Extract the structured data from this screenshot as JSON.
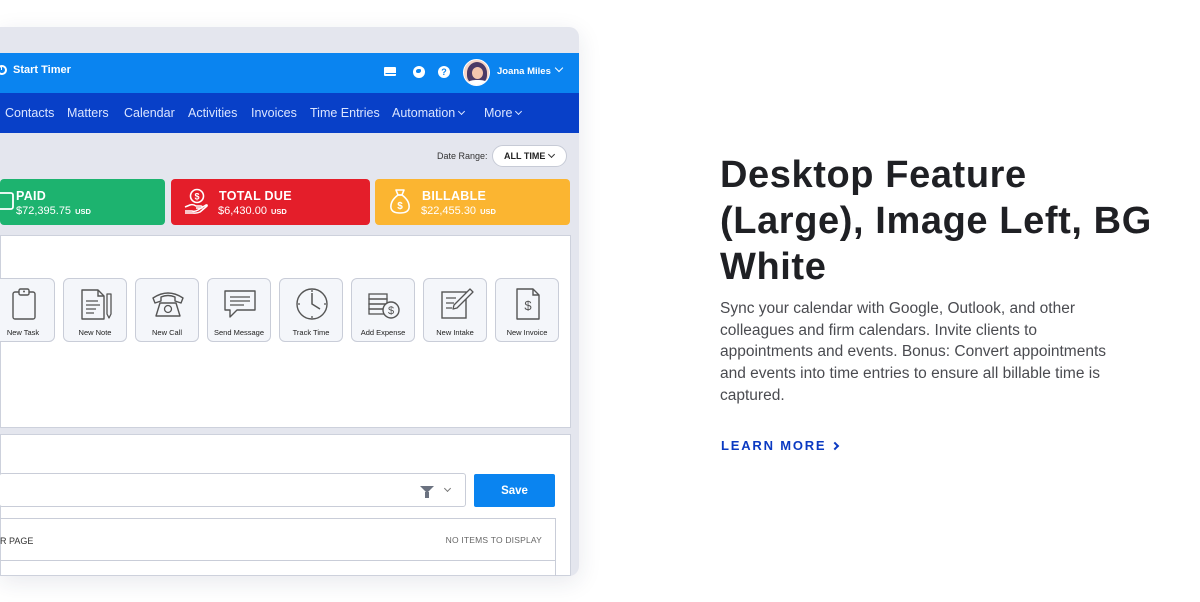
{
  "app": {
    "topbar": {
      "start_timer": "Start Timer",
      "user_name": "Joana Miles"
    },
    "nav": {
      "items": [
        "Contacts",
        "Matters",
        "Calendar",
        "Activities",
        "Invoices",
        "Time Entries",
        "Automation",
        "More"
      ]
    },
    "date_range": {
      "label": "Date Range:",
      "value": "ALL TIME"
    },
    "stats": {
      "paid": {
        "title": "PAID",
        "amount": "$72,395.75",
        "currency": "USD",
        "color": "#1db36f"
      },
      "total_due": {
        "title": "TOTAL DUE",
        "amount": "$6,430.00",
        "currency": "USD",
        "color": "#e41e2a"
      },
      "billable": {
        "title": "BILLABLE",
        "amount": "$22,455.30",
        "currency": "USD",
        "color": "#fbb531"
      }
    },
    "quick_actions": [
      {
        "label": "New Task",
        "icon": "clipboard-icon"
      },
      {
        "label": "New Note",
        "icon": "note-icon"
      },
      {
        "label": "New Call",
        "icon": "phone-icon"
      },
      {
        "label": "Send Message",
        "icon": "message-icon"
      },
      {
        "label": "Track Time",
        "icon": "clock-icon"
      },
      {
        "label": "Add Expense",
        "icon": "expense-icon"
      },
      {
        "label": "New Intake",
        "icon": "intake-icon"
      },
      {
        "label": "New Invoice",
        "icon": "invoice-icon"
      }
    ],
    "filter": {
      "save_label": "Save",
      "per_page_text": "R PAGE",
      "no_items": "NO ITEMS TO DISPLAY"
    }
  },
  "feature": {
    "heading": "Desktop Feature (Large), Image Left, BG White",
    "body": "Sync your calendar with Google, Outlook, and other colleagues and firm calendars. Invite clients to appointments and events. Bonus: Convert appointments and events into time entries to ensure all billable time is captured.",
    "cta": "LEARN MORE"
  },
  "colors": {
    "topbar": "#0a84f0",
    "navbar": "#0840c8",
    "cta": "#0b3ac2"
  }
}
